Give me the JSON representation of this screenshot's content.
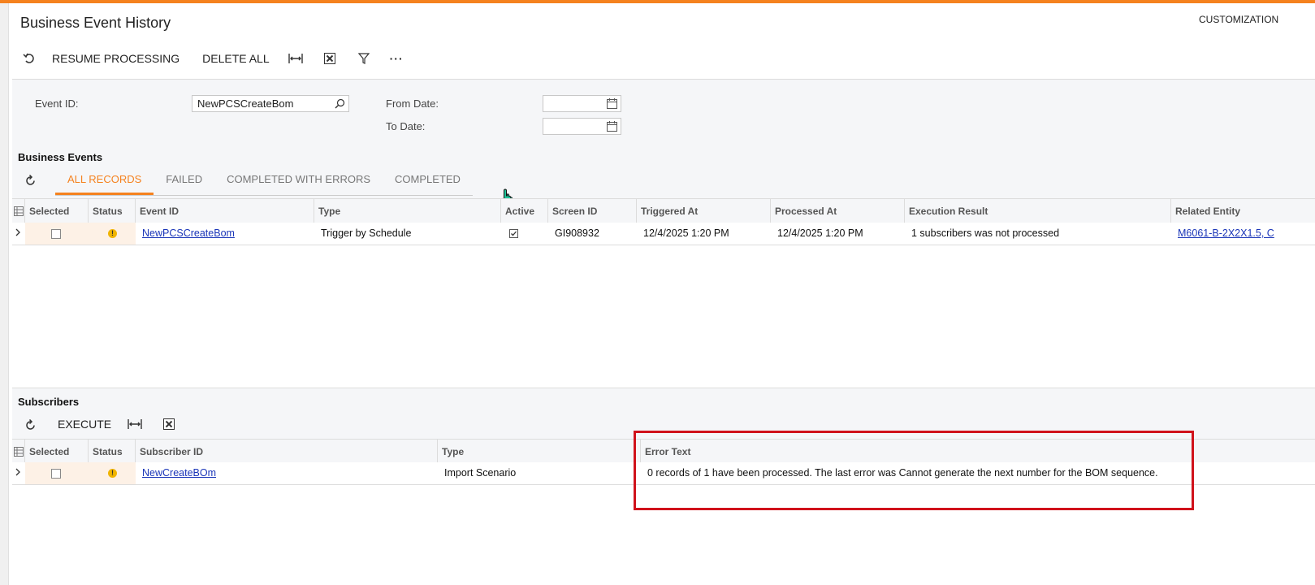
{
  "window": {
    "title": "Business Event History",
    "customization_label": "CUSTOMIZATION"
  },
  "toolbar": {
    "undo_icon": "undo-icon",
    "resume_label": "RESUME PROCESSING",
    "delete_all_label": "DELETE ALL",
    "more_label": "···"
  },
  "filters": {
    "event_id_label": "Event ID:",
    "event_id_value": "NewPCSCreateBom",
    "from_date_label": "From Date:",
    "from_date_value": "",
    "to_date_label": "To Date:",
    "to_date_value": ""
  },
  "business_events": {
    "title": "Business Events",
    "tabs": [
      {
        "label": "ALL RECORDS",
        "active": true
      },
      {
        "label": "FAILED",
        "active": false
      },
      {
        "label": "COMPLETED WITH ERRORS",
        "active": false
      },
      {
        "label": "COMPLETED",
        "active": false
      }
    ],
    "columns": [
      "Selected",
      "Status",
      "Event ID",
      "Type",
      "Active",
      "Screen ID",
      "Triggered At",
      "Processed At",
      "Execution Result",
      "Related Entity"
    ],
    "rows": [
      {
        "event_id": "NewPCSCreateBom",
        "type": "Trigger by Schedule",
        "screen_id": "GI908932",
        "triggered_at": "12/4/2025 1:20 PM",
        "processed_at": "12/4/2025 1:20 PM",
        "execution_result": "1 subscribers was not processed",
        "related_entity": "M6061-B-2X2X1.5, C"
      }
    ]
  },
  "subscribers": {
    "title": "Subscribers",
    "execute_label": "EXECUTE",
    "columns": [
      "Selected",
      "Status",
      "Subscriber ID",
      "Type",
      "Error Text"
    ],
    "rows": [
      {
        "subscriber_id": "NewCreateBOm",
        "type": "Import Scenario",
        "error_text": "0 records of 1 have been processed. The last error was Cannot generate the next number for the BOM sequence."
      }
    ]
  },
  "colors": {
    "accent": "#f5821f",
    "highlight_box": "#d0121b",
    "link": "#1a35b8",
    "row_selected": "#fdf1e6"
  }
}
